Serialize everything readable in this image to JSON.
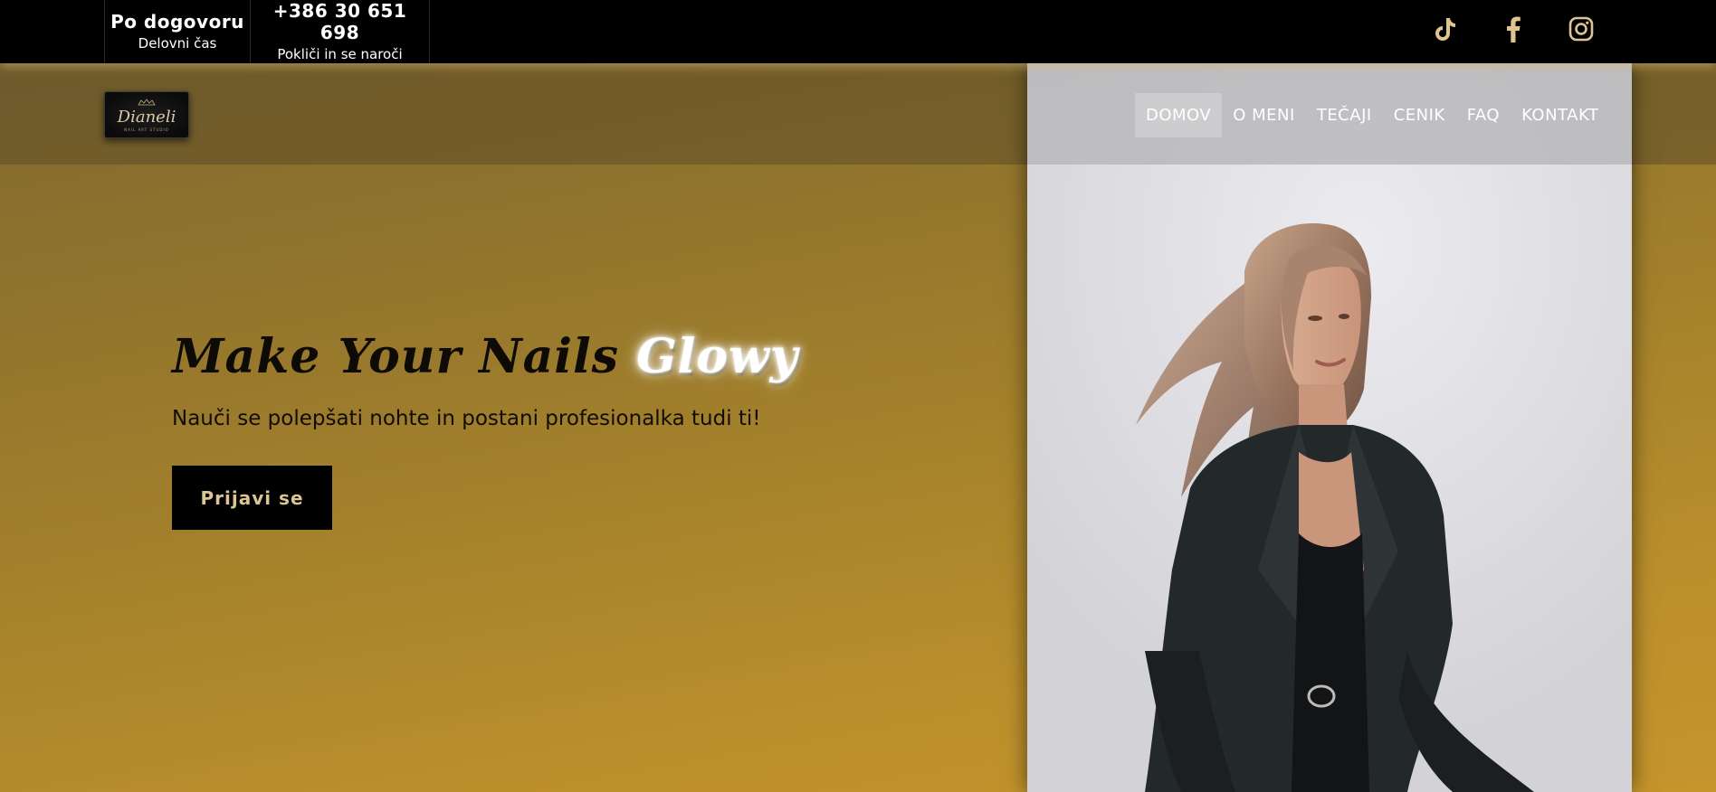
{
  "topbar": {
    "hours_title": "Po dogovoru",
    "hours_subtitle": "Delovni čas",
    "phone_number": "+386 30 651 698",
    "phone_subtitle": "Pokliči in se naroči",
    "social": [
      {
        "name": "tiktok-icon"
      },
      {
        "name": "facebook-icon"
      },
      {
        "name": "instagram-icon"
      }
    ],
    "icon_color": "#e0c48f"
  },
  "logo": {
    "script": "Dianeli",
    "subtitle": "NAIL ART STUDIO"
  },
  "nav": {
    "items": [
      {
        "label": "DOMOV",
        "active": true
      },
      {
        "label": "O MENI",
        "active": false
      },
      {
        "label": "TEČAJI",
        "active": false
      },
      {
        "label": "CENIK",
        "active": false
      },
      {
        "label": "FAQ",
        "active": false
      },
      {
        "label": "KONTAKT",
        "active": false
      }
    ]
  },
  "hero": {
    "title_main": "Make Your Nails ",
    "title_glow": "Glowy",
    "subtitle": "Nauči se polepšati nohte in postani profesionalka tudi ti!",
    "cta_label": "Prijavi se"
  },
  "colors": {
    "topbar_bg": "#000000",
    "accent_gold": "#c6952c",
    "cta_text": "#dcc594"
  }
}
